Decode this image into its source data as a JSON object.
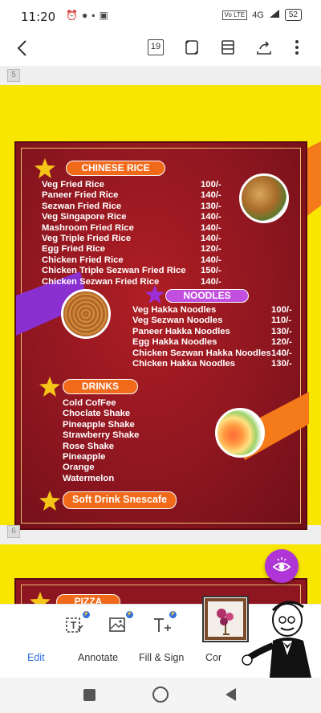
{
  "status_bar": {
    "time": "11:20",
    "left_icons": [
      "alarm-icon",
      "chat-icon",
      "notification-icon",
      "gallery-icon"
    ],
    "network": "4G",
    "battery": "52"
  },
  "toolbar": {
    "page_count": "19",
    "icons": [
      "back-arrow-icon",
      "page-count-icon",
      "reading-mode-icon",
      "page-layout-icon",
      "share-icon",
      "more-options-icon"
    ]
  },
  "document": {
    "page_numbers": [
      "5",
      "6"
    ],
    "chinese_rice": {
      "title": "CHINESE RICE",
      "items": [
        {
          "name": "Veg Fried Rice",
          "price": "100/-"
        },
        {
          "name": "Paneer Fried Rice",
          "price": "140/-"
        },
        {
          "name": "Sezwan Fried Rice",
          "price": "130/-"
        },
        {
          "name": "Veg Singapore Rice",
          "price": "140/-"
        },
        {
          "name": "Mashroom Fried Rice",
          "price": "140/-"
        },
        {
          "name": "Veg Triple Fried Rice",
          "price": "140/-"
        },
        {
          "name": "Egg Fried Rice",
          "price": "120/-"
        },
        {
          "name": "Chicken Fried Rice",
          "price": "140/-"
        },
        {
          "name": "Chicken Triple Sezwan Fried Rice",
          "price": "150/-"
        },
        {
          "name": "Chicken Sezwan Fried Rice",
          "price": "140/-"
        }
      ]
    },
    "noodles": {
      "title": "NOODLES",
      "items": [
        {
          "name": "Veg Hakka Noodles",
          "price": "100/-"
        },
        {
          "name": "Veg Sezwan Noodles",
          "price": "110/-"
        },
        {
          "name": "Paneer Hakka Noodles",
          "price": "130/-"
        },
        {
          "name": "Egg Hakka Noodles",
          "price": "120/-"
        },
        {
          "name": "Chicken Sezwan Hakka Noodles",
          "price": "140/-"
        },
        {
          "name": "Chicken Hakka Noodles",
          "price": "130/-"
        }
      ]
    },
    "drinks": {
      "title": "DRINKS",
      "items": [
        "Cold CofFee",
        "Choclate Shake",
        "Pineapple Shake",
        "Strawberry Shake",
        "Rose Shake",
        "Pineapple",
        "Orange",
        "Watermelon"
      ]
    },
    "soft_drink": "Soft Drink Snescafe",
    "next_page_title": "PIZZA"
  },
  "bottom_tools": [
    {
      "label": "Edit",
      "icon": "edit-text-icon",
      "active": true
    },
    {
      "label": "Annotate",
      "icon": "annotate-image-icon",
      "active": false
    },
    {
      "label": "Fill & Sign",
      "icon": "fill-sign-icon",
      "active": false
    },
    {
      "label": "Cor",
      "icon": "convert-icon",
      "active": false
    }
  ],
  "nav_bar": [
    "recents-button",
    "home-button",
    "back-button"
  ],
  "colors": {
    "page_yellow": "#f8e600",
    "menu_red": "#9a1a22",
    "orange_pill": "#f06a1a",
    "purple_pill": "#c34fe0",
    "accent_blue": "#2f6fe0",
    "fab_purple": "#b035d6"
  }
}
